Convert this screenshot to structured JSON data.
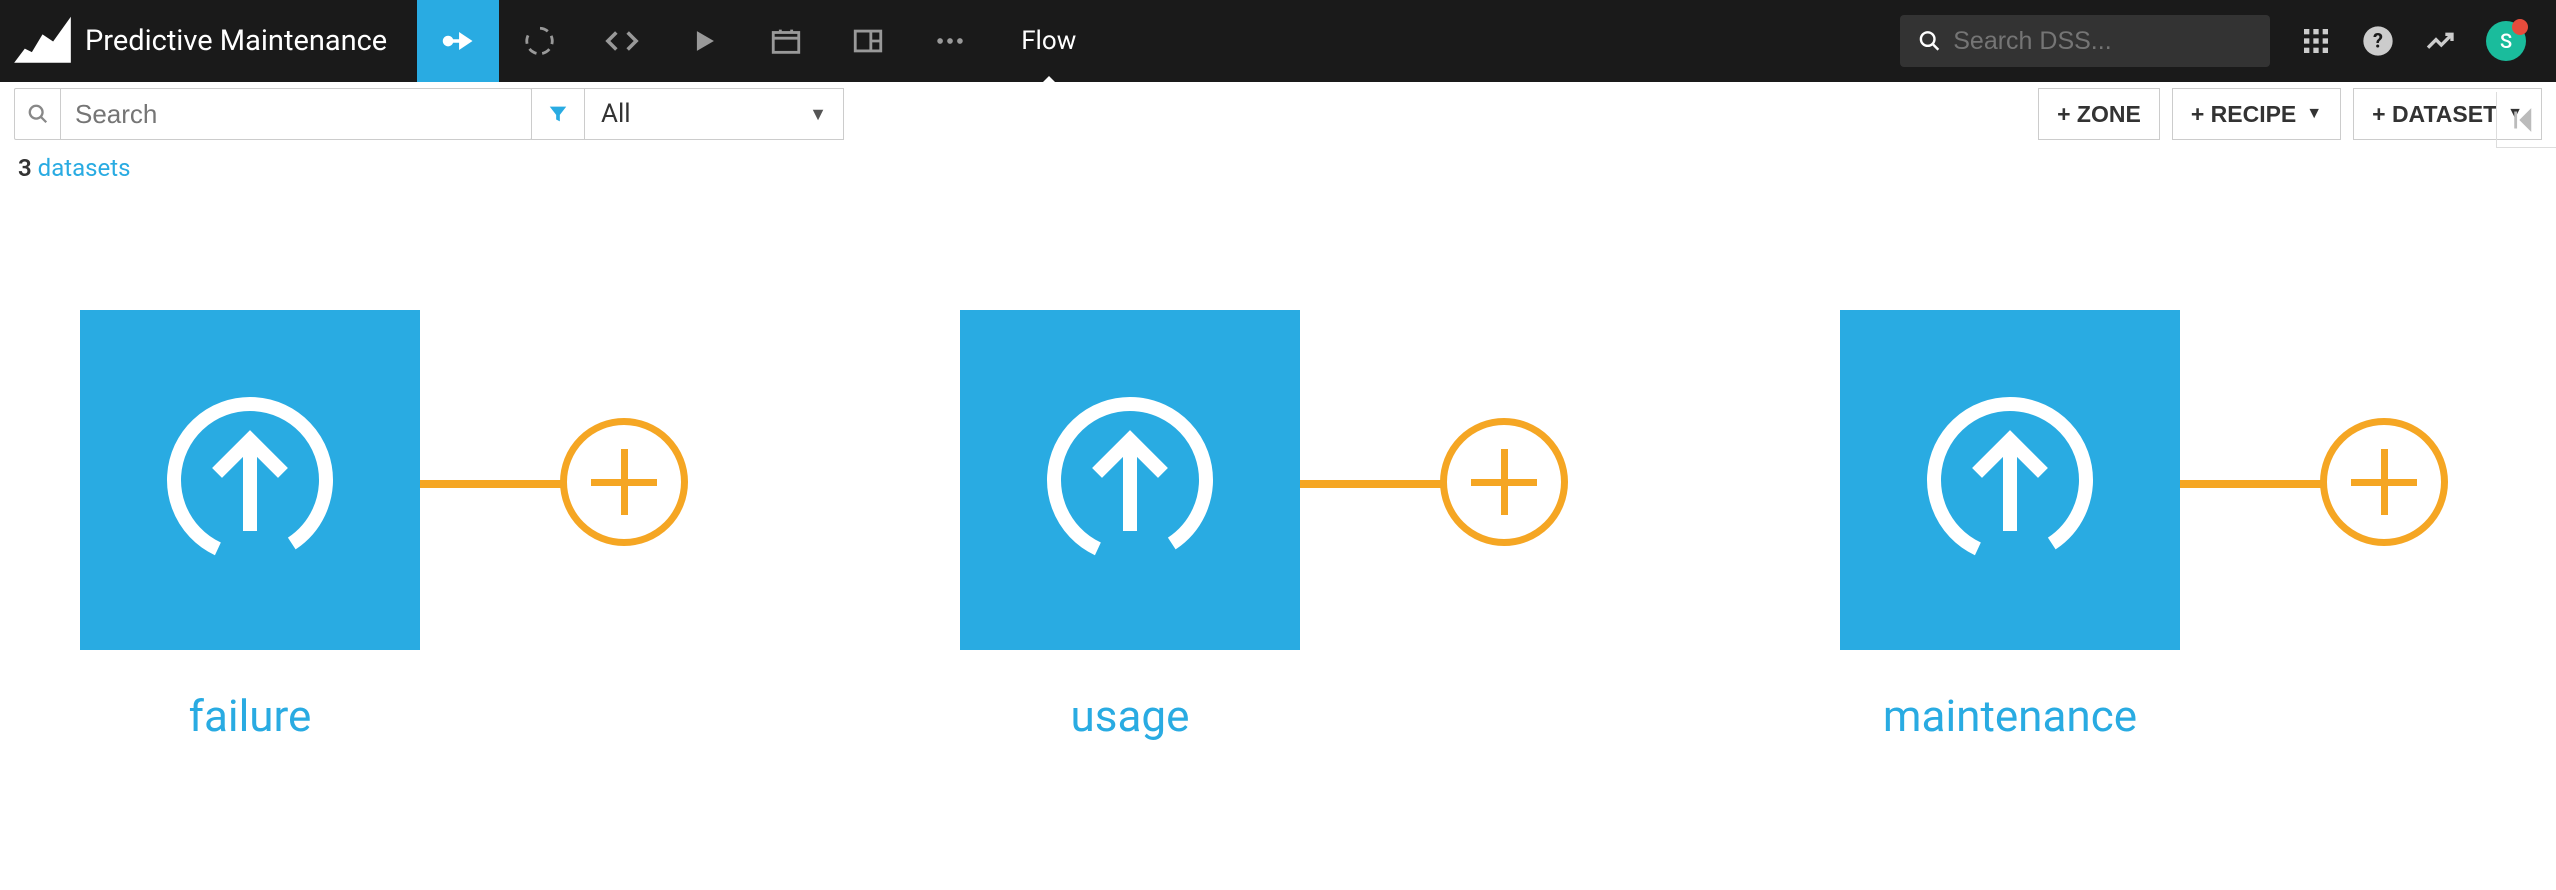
{
  "header": {
    "project_title": "Predictive Maintenance",
    "page_label": "Flow",
    "search_placeholder": "Search DSS...",
    "avatar_initial": "S"
  },
  "subbar": {
    "search_placeholder": "Search",
    "filter_value": "All",
    "buttons": {
      "zone": "+ ZONE",
      "recipe": "+ RECIPE",
      "dataset": "+ DATASET"
    }
  },
  "status": {
    "count": "3",
    "label": "datasets"
  },
  "nodes": [
    {
      "label": "failure"
    },
    {
      "label": "usage"
    },
    {
      "label": "maintenance"
    }
  ]
}
